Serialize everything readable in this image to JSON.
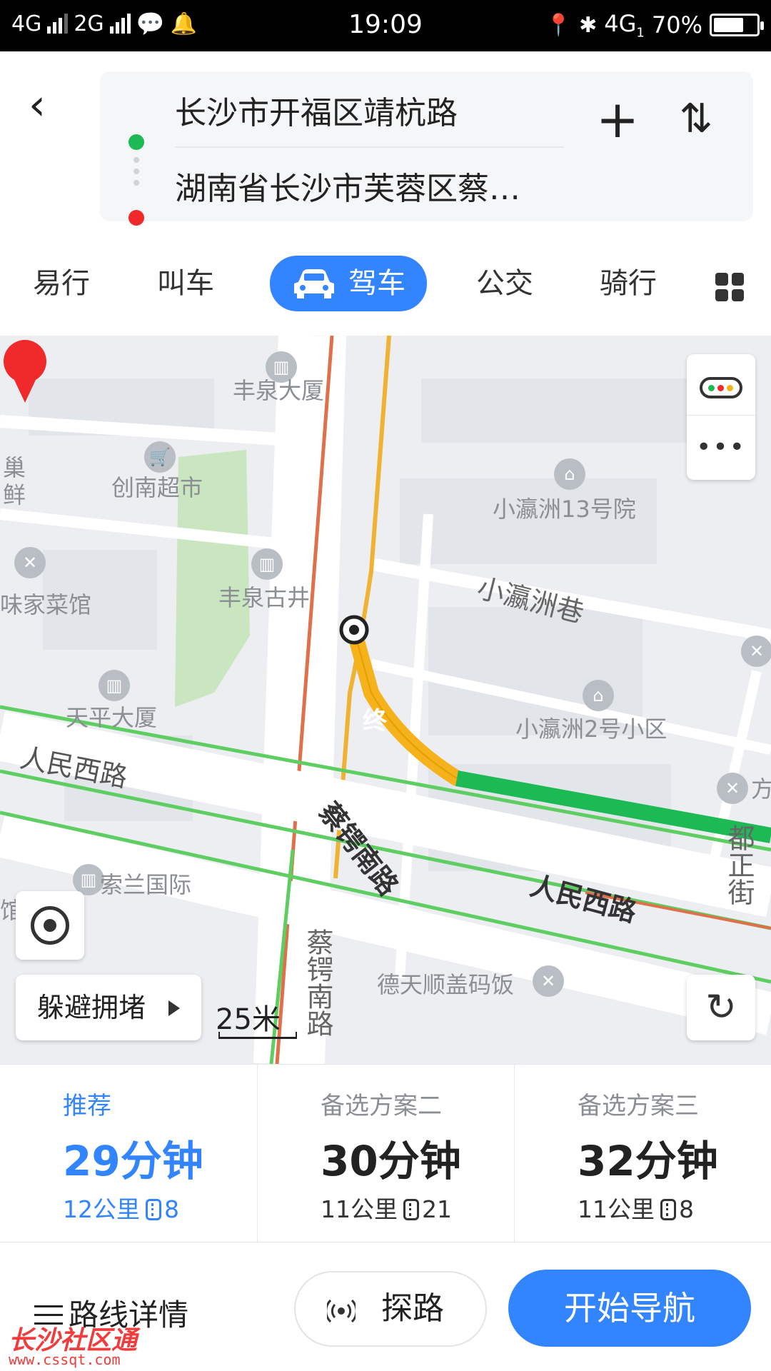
{
  "status_bar": {
    "network1": "4G",
    "network2": "2G",
    "time": "19:09",
    "network3": "4G",
    "network3_sub": "1",
    "battery": "70%",
    "battery_level": 0.7
  },
  "route": {
    "start": "长沙市开福区靖杭路",
    "end": "湖南省长沙市芙蓉区蔡…"
  },
  "tabs": [
    {
      "label": "易行"
    },
    {
      "label": "叫车"
    },
    {
      "label": "驾车"
    },
    {
      "label": "公交"
    },
    {
      "label": "骑行"
    }
  ],
  "active_tab": "驾车",
  "map": {
    "pois": [
      "丰泉大厦",
      "创南超市",
      "小瀛洲13号院",
      "丰泉古井",
      "小瀛洲巷",
      "味家菜馆",
      "天平大厦",
      "小瀛洲2号小区",
      "索兰国际",
      "德天顺盖码饭"
    ],
    "roads": [
      "人民西路",
      "蔡锷南路",
      "人民西路",
      "蔡锷南路",
      "都正街"
    ],
    "edge_text": [
      "巢",
      "鲜",
      "方",
      "馆"
    ],
    "end_marker": "终",
    "avoid_congestion": "躲避拥堵",
    "scale": "25米"
  },
  "plans": [
    {
      "tag": "推荐",
      "time": "29分钟",
      "distance": "12公里",
      "lights": "8"
    },
    {
      "tag": "备选方案二",
      "time": "30分钟",
      "distance": "11公里",
      "lights": "21"
    },
    {
      "tag": "备选方案三",
      "time": "32分钟",
      "distance": "11公里",
      "lights": "8"
    }
  ],
  "bottom": {
    "details": "路线详情",
    "probe": "探路",
    "navigate": "开始导航"
  },
  "watermark": {
    "name": "长沙社区通",
    "url": "www.cssqt.com"
  },
  "colors": {
    "accent": "#3385ff",
    "traffic_green": "#1db954",
    "traffic_yellow": "#f5b21b",
    "route_red": "#f02a2a"
  },
  "icons": [
    "back-icon",
    "plus-icon",
    "swap-icon",
    "car-icon",
    "grid-icon",
    "traffic-icon",
    "more-icon",
    "locate-icon",
    "refresh-icon",
    "list-icon",
    "probe-icon"
  ]
}
